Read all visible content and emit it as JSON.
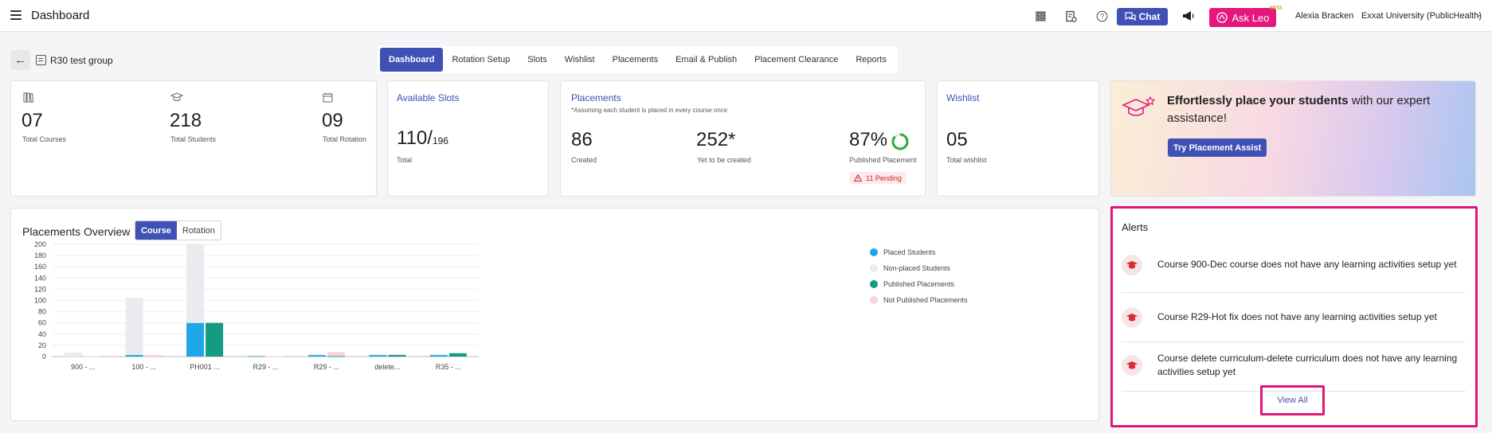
{
  "header": {
    "title": "Dashboard",
    "chat_label": "Chat",
    "askleo_label": "Ask Leo",
    "beta_label": "BETA",
    "user_name": "Alexia Bracken",
    "org_name": "Exxat University (PublicHealth)"
  },
  "subheader": {
    "group_name": "R30 test group",
    "tabs": [
      {
        "label": "Dashboard",
        "active": true
      },
      {
        "label": "Rotation Setup"
      },
      {
        "label": "Slots"
      },
      {
        "label": "Wishlist"
      },
      {
        "label": "Placements"
      },
      {
        "label": "Email & Publish"
      },
      {
        "label": "Placement Clearance"
      },
      {
        "label": "Reports"
      }
    ]
  },
  "stats": {
    "courses": {
      "value": "07",
      "label": "Total Courses"
    },
    "students": {
      "value": "218",
      "label": "Total Students"
    },
    "rotation": {
      "value": "09",
      "label": "Total Rotation"
    }
  },
  "available_slots": {
    "title": "Available Slots",
    "value": "110/",
    "total": "196",
    "label": "Total"
  },
  "placements": {
    "title": "Placements",
    "note": "*Assuming each student is placed in every course once",
    "created_value": "86",
    "created_label": "Created",
    "yet_value": "252*",
    "yet_label": "Yet to be created",
    "published_value": "87%",
    "published_label": "Published Placement",
    "pending_label": "11 Pending",
    "published_fraction": 0.87
  },
  "wishlist": {
    "title": "Wishlist",
    "value": "05",
    "label": "Total wishlist"
  },
  "promo": {
    "headline_bold": "Effortlessly place your students",
    "headline_rest": " with our expert assistance!",
    "button_label": "Try Placement Assist"
  },
  "overview": {
    "title": "Placements Overview",
    "toggle_course": "Course",
    "toggle_rotation": "Rotation"
  },
  "chart_data": {
    "type": "bar",
    "categories": [
      "900 - ...",
      "100 - ...",
      "PH001 ...",
      "R29 - ...",
      "R29 - ...",
      "delete...",
      "R35 - ..."
    ],
    "ylim": [
      0,
      200
    ],
    "yticks": [
      "0",
      "20",
      "40",
      "60",
      "80",
      "100",
      "120",
      "140",
      "160",
      "180",
      "200"
    ],
    "legend_position": "right",
    "series": [
      {
        "name": "Placed Students",
        "color": "#1ea7e8",
        "values": [
          0,
          3,
          60,
          1,
          3,
          3,
          3
        ],
        "stack": "students"
      },
      {
        "name": "Non-placed Students",
        "color": "#e9ebef",
        "values": [
          7,
          102,
          140,
          1,
          1,
          1,
          1
        ],
        "stack": "students"
      },
      {
        "name": "Published Placements",
        "color": "#159b82",
        "values": [
          0,
          0,
          60,
          0,
          1,
          3,
          6
        ],
        "stack": "placements"
      },
      {
        "name": "Not Published Placements",
        "color": "#f8d3d8",
        "values": [
          1,
          3,
          0,
          1,
          7,
          0,
          0
        ],
        "stack": "placements"
      }
    ]
  },
  "alerts": {
    "title": "Alerts",
    "items": [
      {
        "text": "Course 900-Dec course does not have any learning activities setup yet"
      },
      {
        "text": "Course R29-Hot fix does not have any learning activities setup yet"
      },
      {
        "text": "Course delete curriculum-delete curriculum does not have any learning activities setup yet"
      }
    ],
    "view_all_label": "View All"
  },
  "colors": {
    "accent": "#3f51b5",
    "brand_pink": "#e5177e",
    "highlight": "#e0157a"
  }
}
